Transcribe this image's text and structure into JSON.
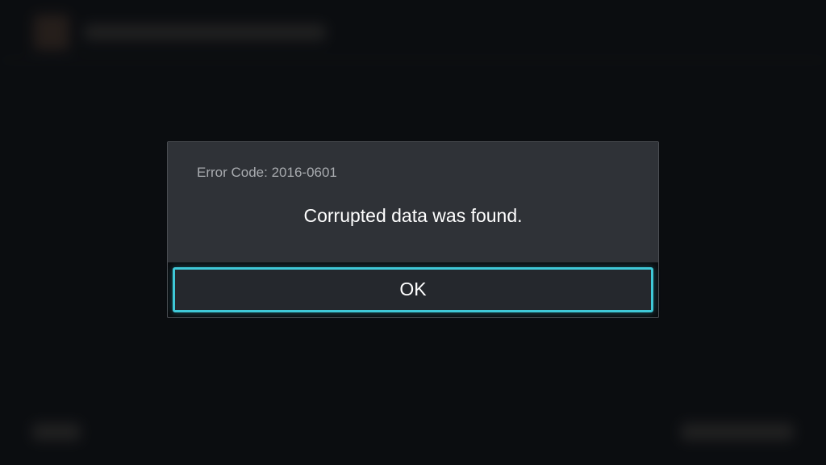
{
  "dialog": {
    "error_code_label": "Error Code: 2016-0601",
    "message": "Corrupted data was found.",
    "confirm_label": "OK"
  },
  "colors": {
    "accent": "#3fc9d8",
    "dialog_bg": "#2f3237",
    "page_bg": "#12151a"
  }
}
